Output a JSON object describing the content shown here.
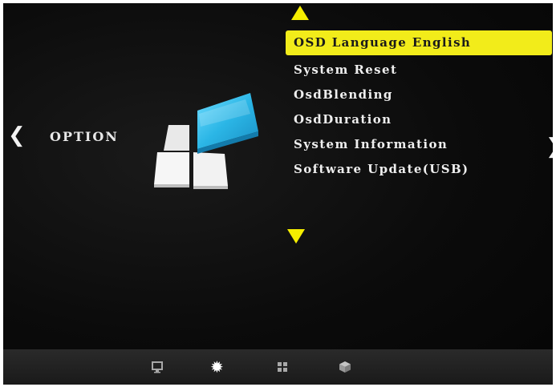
{
  "section": {
    "title": "OPTION"
  },
  "menu": {
    "items": [
      {
        "label": "OSD Language English",
        "selected": true
      },
      {
        "label": "System Reset",
        "selected": false
      },
      {
        "label": "OsdBlending",
        "selected": false
      },
      {
        "label": "OsdDuration",
        "selected": false
      },
      {
        "label": "System Information",
        "selected": false
      },
      {
        "label": "Software Update(USB)",
        "selected": false
      }
    ]
  },
  "navigation": {
    "left_icon": "chevron-left-icon",
    "right_icon": "chevron-right-icon",
    "scroll_up_icon": "triangle-up-icon",
    "scroll_down_icon": "triangle-down-icon"
  },
  "bottom_tabs": [
    {
      "icon": "monitor-icon",
      "active": false
    },
    {
      "icon": "gear-icon",
      "active": true
    },
    {
      "icon": "grid-icon",
      "active": false
    },
    {
      "icon": "cube-icon",
      "active": false
    }
  ],
  "colors": {
    "highlight": "#f2ec1a",
    "arrow": "#f5ee00",
    "text": "#eeeeee",
    "background": "#0b0b0b",
    "tile_blue": "#2bb6e6",
    "tile_white": "#f4f4f4"
  }
}
